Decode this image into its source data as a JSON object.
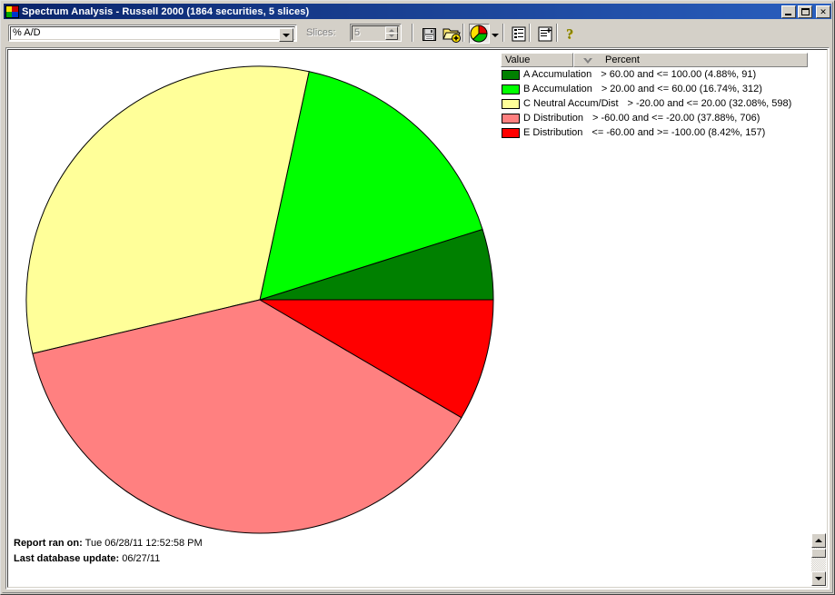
{
  "window": {
    "title": "Spectrum Analysis - Russell 2000 (1864 securities, 5 slices)",
    "icon": "spectrum-app-icon",
    "buttons": {
      "minimize": "minimize-icon",
      "maximize": "maximize-icon",
      "close": "✕"
    }
  },
  "toolbar": {
    "measure_value": "% A/D",
    "measure_placeholder": "% A/D",
    "dropdown_icon": "chevron-down-icon",
    "slices_label": "Slices:",
    "slices_value": "5",
    "buttons": [
      {
        "name": "save-button",
        "icon": "floppy-disk-icon"
      },
      {
        "name": "open-add-button",
        "icon": "folder-add-icon"
      },
      {
        "name": "pie-chart-view-button",
        "icon": "pie-chart-icon",
        "pressed": true
      },
      {
        "name": "pie-chart-options-button",
        "icon": "chevron-down-icon"
      },
      {
        "name": "list-report-button",
        "icon": "report-list-icon"
      },
      {
        "name": "new-report-button",
        "icon": "report-add-icon"
      },
      {
        "name": "help-button",
        "icon": "question-mark-icon"
      }
    ]
  },
  "legend": {
    "columns": [
      "Value",
      "Percent"
    ],
    "sort_column": "Percent",
    "sort_icon": "sort-descending-icon",
    "rows": [
      {
        "color": "#008000",
        "name": "A Accumulation",
        "range": "> 60.00 and <= 100.00 (4.88%, 91)"
      },
      {
        "color": "#00FF00",
        "name": "B Accumulation",
        "range": "> 20.00 and <= 60.00 (16.74%, 312)"
      },
      {
        "color": "#FFFF99",
        "name": "C Neutral Accum/Dist",
        "range": "> -20.00 and <= 20.00 (32.08%, 598)"
      },
      {
        "color": "#FF8080",
        "name": "D Distribution",
        "range": "> -60.00 and <= -20.00 (37.88%, 706)"
      },
      {
        "color": "#FF0000",
        "name": "E Distribution",
        "range": "<= -60.00 and >= -100.00 (8.42%, 157)"
      }
    ]
  },
  "footer": {
    "ran_label": "Report ran on:",
    "ran_value": "Tue 06/28/11 12:52:58 PM",
    "update_label": "Last database update:",
    "update_value": "06/27/11"
  },
  "scrollbar": {
    "up_icon": "scroll-up-arrow-icon",
    "down_icon": "scroll-down-arrow-icon"
  },
  "chart_data": {
    "type": "pie",
    "title": "Spectrum Analysis - Russell 2000",
    "total_securities": 1864,
    "slices": 5,
    "start_angle_deg": 0,
    "direction": "counterclockwise",
    "center": [
      277,
      324
    ],
    "radius": 257,
    "labels": [
      "A Accumulation",
      "B Accumulation",
      "C Neutral Accum/Dist",
      "D Distribution",
      "E Distribution"
    ],
    "values": [
      4.88,
      16.74,
      32.08,
      37.88,
      8.42
    ],
    "counts": [
      91,
      312,
      598,
      706,
      157
    ],
    "colors": [
      "#008000",
      "#00FF00",
      "#FFFF99",
      "#FF8080",
      "#FF0000"
    ],
    "ranges": [
      "> 60.00 and <= 100.00",
      "> 20.00 and <= 60.00",
      "> -20.00 and <= 20.00",
      "> -60.00 and <= -20.00",
      "<= -60.00 and >= -100.00"
    ],
    "ylabel": "",
    "xlabel": "",
    "legend_position": "right",
    "grid": false
  }
}
